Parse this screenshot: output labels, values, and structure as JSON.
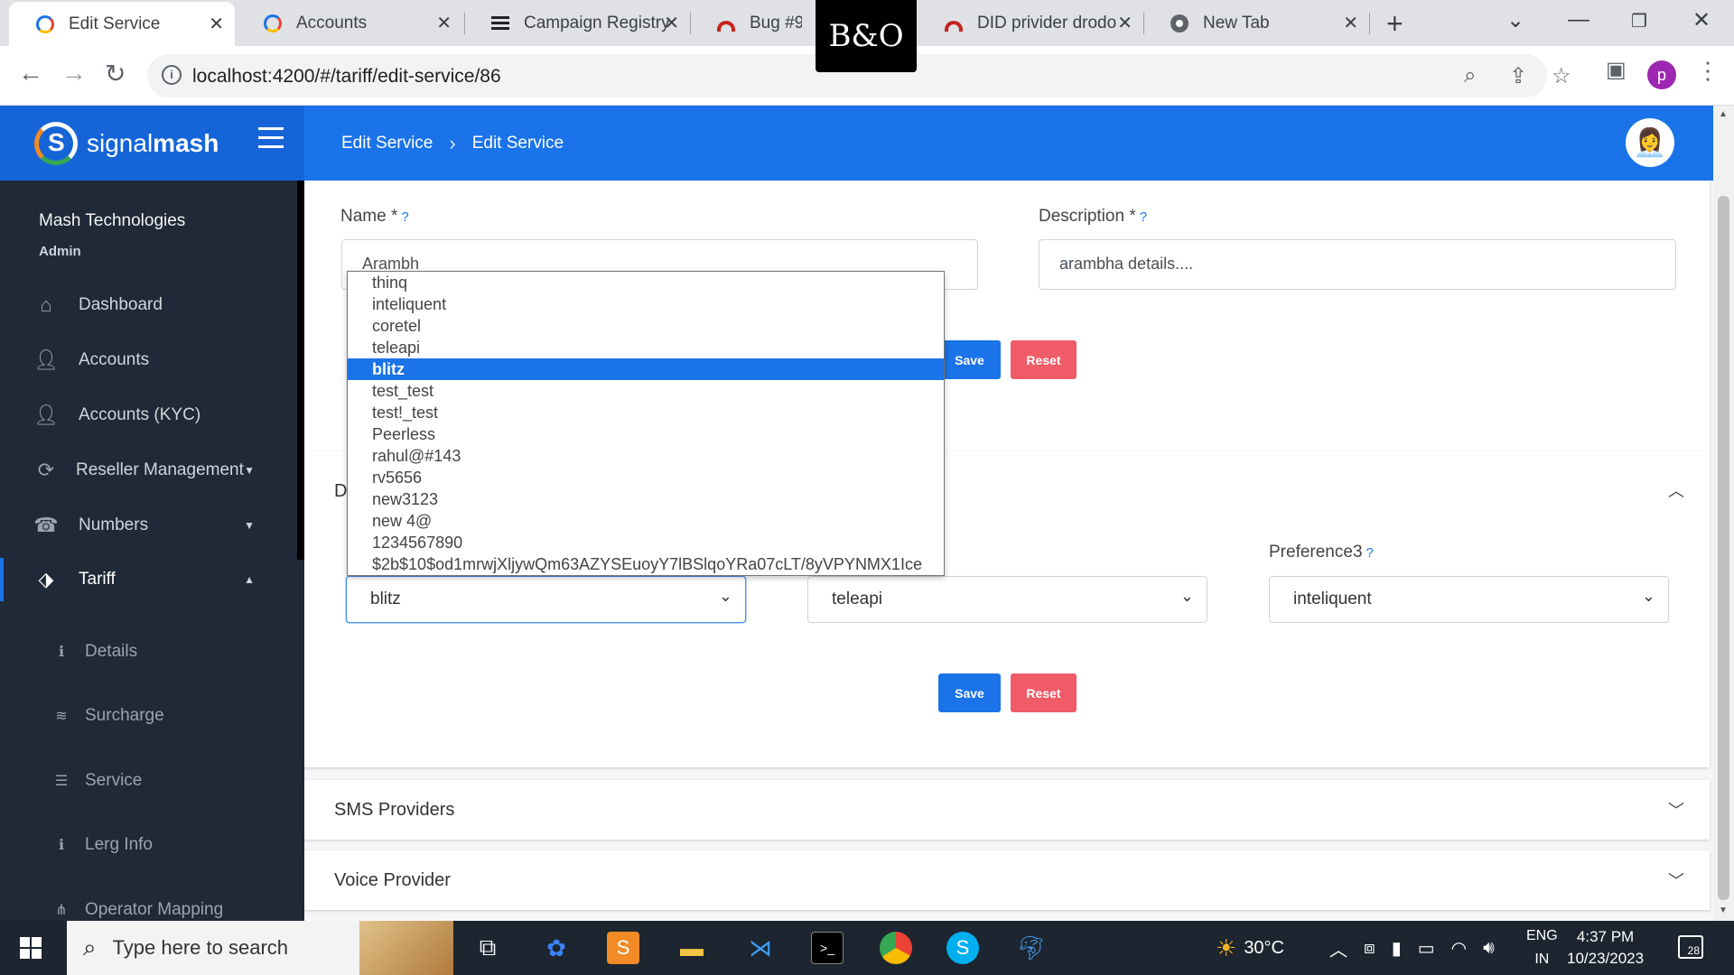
{
  "browser": {
    "tabs": [
      {
        "label": "Edit Service",
        "active": true,
        "icon": "signalmash-icon"
      },
      {
        "label": "Accounts",
        "active": false,
        "icon": "signalmash-icon"
      },
      {
        "label": "Campaign Registry",
        "active": false,
        "icon": "list-icon"
      },
      {
        "label": "Bug #9640",
        "active": false,
        "icon": "arc-icon"
      },
      {
        "label": "DID privider drodo",
        "active": false,
        "icon": "arc-icon"
      },
      {
        "label": "New Tab",
        "active": false,
        "icon": "chrome-icon"
      }
    ],
    "url": "localhost:4200/#/tariff/edit-service/86",
    "profile_initial": "p",
    "overlay_logo": "B&O"
  },
  "header": {
    "logo_text_light": "signal",
    "logo_text_bold": "mash",
    "breadcrumb": [
      "Edit Service",
      "Edit Service"
    ],
    "brand_color": "#1a73e8"
  },
  "sidebar": {
    "org_name": "Mash Technologies",
    "role": "Admin",
    "items": [
      {
        "label": "Dashboard",
        "icon": "home-icon"
      },
      {
        "label": "Accounts",
        "icon": "user-icon"
      },
      {
        "label": "Accounts (KYC)",
        "icon": "user-plus-icon"
      },
      {
        "label": "Reseller Management",
        "icon": "sync-icon",
        "has_caret": true
      },
      {
        "label": "Numbers",
        "icon": "phone-icon",
        "has_caret": true
      },
      {
        "label": "Tariff",
        "icon": "tag-icon",
        "has_caret": true,
        "active": true
      }
    ],
    "sub_items": [
      {
        "label": "Details",
        "icon": "info-icon"
      },
      {
        "label": "Surcharge",
        "icon": "coins-icon"
      },
      {
        "label": "Service",
        "icon": "sliders-icon"
      },
      {
        "label": "Lerg Info",
        "icon": "info-icon"
      },
      {
        "label": "Operator Mapping",
        "icon": "sitemap-icon"
      }
    ]
  },
  "form": {
    "name_label": "Name *",
    "name_value": "Arambh",
    "description_label": "Description *",
    "description_value": "arambha details....",
    "help_mark": "?",
    "save_label": "Save",
    "reset_label": "Reset"
  },
  "providers_section": {
    "title_partial": "D",
    "preference3_label": "Preference3",
    "preference1_value": "blitz",
    "preference2_value": "teleapi",
    "preference3_value": "inteliquent",
    "save_label": "Save",
    "reset_label": "Reset"
  },
  "dropdown": {
    "options": [
      "thinq",
      "inteliquent",
      "coretel",
      "teleapi",
      "blitz",
      "test_test",
      "test!_test",
      "Peerless",
      "rahul@#143",
      "rv5656",
      "new3123",
      "new 4@",
      "1234567890",
      "$2b$10$od1mrwjXljywQm63AZYSEuoyY7lBSlqoYRa07cLT/8yVPYNMX1Ice"
    ],
    "selected": "blitz"
  },
  "accordions": {
    "sms": "SMS Providers",
    "voice": "Voice Provider"
  },
  "taskbar": {
    "search_placeholder": "Type here to search",
    "temperature": "30°C",
    "language": "ENG",
    "region": "IN",
    "time": "4:37 PM",
    "date": "10/23/2023",
    "notifications": "28"
  }
}
